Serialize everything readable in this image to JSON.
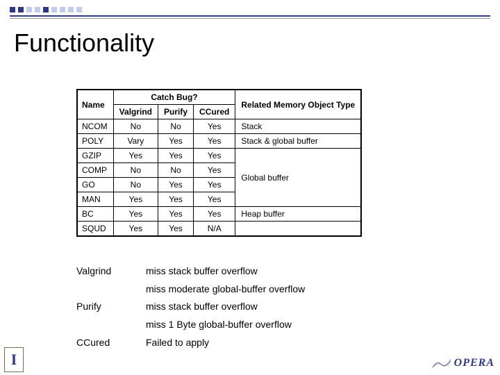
{
  "title": "Functionality",
  "table": {
    "headers": {
      "name": "Name",
      "catch": "Catch Bug?",
      "mem": "Related Memory Object Type",
      "tools": [
        "Valgrind",
        "Purify",
        "CCured"
      ]
    },
    "rows": [
      {
        "name": "NCOM",
        "v": "No",
        "p": "No",
        "c": "Yes",
        "mem": "Stack"
      },
      {
        "name": "POLY",
        "v": "Vary",
        "p": "Yes",
        "c": "Yes",
        "mem": "Stack & global buffer"
      },
      {
        "name": "GZIP",
        "v": "Yes",
        "p": "Yes",
        "c": "Yes"
      },
      {
        "name": "COMP",
        "v": "No",
        "p": "No",
        "c": "Yes"
      },
      {
        "name": "GO",
        "v": "No",
        "p": "Yes",
        "c": "Yes",
        "mem": "Global buffer"
      },
      {
        "name": "MAN",
        "v": "Yes",
        "p": "Yes",
        "c": "Yes"
      },
      {
        "name": "BC",
        "v": "Yes",
        "p": "Yes",
        "c": "Yes",
        "mem": "Heap buffer"
      },
      {
        "name": "SQUD",
        "v": "Yes",
        "p": "Yes",
        "c": "N/A"
      }
    ]
  },
  "notes": [
    {
      "label": "Valgrind",
      "text": "miss stack buffer overflow"
    },
    {
      "label": "",
      "text": "miss moderate global-buffer overflow"
    },
    {
      "label": "Purify",
      "text": "miss stack buffer overflow"
    },
    {
      "label": "",
      "text": "miss 1 Byte global-buffer overflow"
    },
    {
      "label": "CCured",
      "text": "Failed to apply"
    }
  ],
  "logos": {
    "left": "I",
    "right": "OPERA"
  }
}
